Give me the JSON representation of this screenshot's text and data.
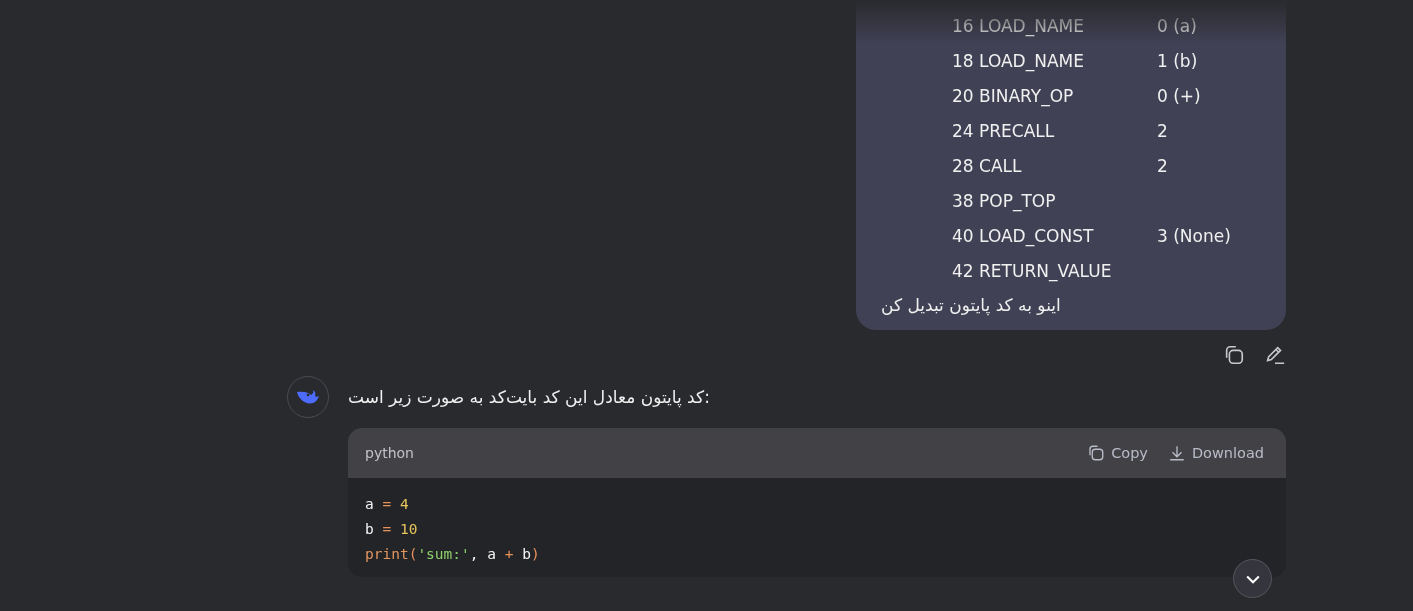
{
  "user_message": {
    "bytecode_lines": [
      {
        "op": "16 LOAD_NAME",
        "arg": "0 (a)"
      },
      {
        "op": "18 LOAD_NAME",
        "arg": "1 (b)"
      },
      {
        "op": "20 BINARY_OP",
        "arg": "0 (+)"
      },
      {
        "op": "24 PRECALL",
        "arg": "2"
      },
      {
        "op": "28 CALL",
        "arg": "2"
      },
      {
        "op": "38 POP_TOP"
      },
      {
        "op": "40 LOAD_CONST",
        "arg": "3 (None)"
      },
      {
        "op": "42 RETURN_VALUE"
      }
    ],
    "text": "اینو به کد پایتون تبدیل کن"
  },
  "assistant_message": {
    "text": "کد پایتون معادل این کد بایت‌کد به صورت زیر است:",
    "code_block": {
      "language": "python",
      "copy_label": "Copy",
      "download_label": "Download",
      "lines": [
        [
          {
            "kind": "plain",
            "text": "a "
          },
          {
            "kind": "operator",
            "text": "="
          },
          {
            "kind": "number",
            "text": " 4"
          }
        ],
        [
          {
            "kind": "plain",
            "text": "b "
          },
          {
            "kind": "operator",
            "text": "="
          },
          {
            "kind": "number",
            "text": " 10"
          }
        ],
        [
          {
            "kind": "builtin",
            "text": "print"
          },
          {
            "kind": "operator",
            "text": "("
          },
          {
            "kind": "string",
            "text": "'sum:'"
          },
          {
            "kind": "plain",
            "text": ", a "
          },
          {
            "kind": "operator",
            "text": "+"
          },
          {
            "kind": "plain",
            "text": " b"
          },
          {
            "kind": "operator",
            "text": ")"
          }
        ]
      ]
    }
  }
}
